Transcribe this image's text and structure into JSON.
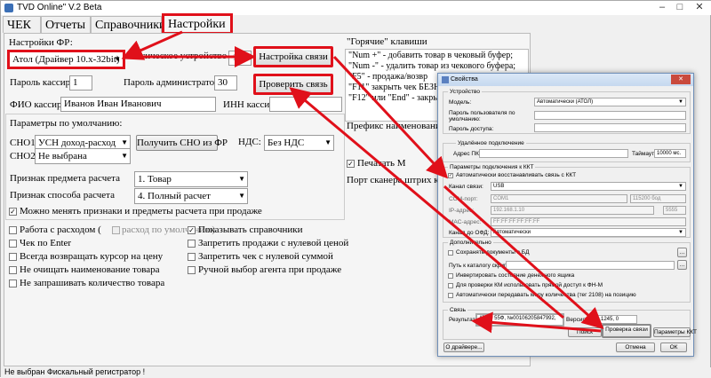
{
  "window": {
    "title": "TVD Online\" V.2 Beta"
  },
  "tabs": [
    "ЧЕК",
    "Отчеты",
    "Справочники",
    "Настройки"
  ],
  "settings": {
    "fr_label": "Настройки ФР:",
    "fr_driver": "Атол (Драйвер 10.х-32bit)",
    "logical_device_label": "Логическое устройство",
    "logical_device_value": "1",
    "connect_settings_button": "Настройка связи",
    "check_connection_button": "Проверить связь",
    "cashier_password_label": "Пароль кассира",
    "cashier_password_value": "1",
    "admin_password_label": "Пароль администратора",
    "admin_password_value": "30",
    "cashier_name_label": "ФИО кассира",
    "cashier_name_value": "Иванов Иван Иванович",
    "cashier_inn_label": "ИНН кассира",
    "defaults_label": "Параметры по умолчанию:",
    "sno1_label": "СНО1:",
    "sno1_value": "УСН доход-расход",
    "sno2_label": "СНО2:",
    "sno2_value": "Не выбрана",
    "get_sno_button": "Получить СНО из ФР",
    "vat_label": "НДС:",
    "vat_value": "Без НДС",
    "calc_subject_label": "Признак предмета расчета",
    "calc_subject_value": "1. Товар",
    "calc_method_label": "Признак способа расчета",
    "calc_method_value": "4. Полный расчет",
    "allow_change_label": "Можно менять признаки и предметы расчета при продаже",
    "options_left": [
      "Работа с расходом (",
      "Чек по Enter",
      "Всегда возвращать курсор на цену",
      "Не очищать наименование товара",
      "Не запрашивать количество товара"
    ],
    "expense_default_label": "расход по умолчанию)",
    "options_right": [
      "Показывать справочники",
      "Запретить продажи с нулевой ценой",
      "Запретить чек с нулевой суммой",
      "Ручной выбор агента при продаже"
    ],
    "hotkeys_title": "\"Горячие\" клавиши",
    "hotkeys": [
      "\"Num +\" - добавить товар в чековый буфер;",
      "\"Num -\"  - удалить товар из чекового буфера;",
      "\"F5\"       - продажа/возвр",
      "\"F11\"   закрыть чек БЕЗН",
      "\"F12\"  или \"End\" - закрыть"
    ],
    "prefix_label": "Префикс наименования то",
    "print_label": "Печатать М",
    "scanner_label": "Порт сканера штрих кодов"
  },
  "status": "Не выбран Фискальный регистратор !",
  "dialog": {
    "title": "Свойства",
    "device_group": "Устройство",
    "model_label": "Модель:",
    "model_value": "Автоматически (АТОЛ)",
    "user_password_label": "Пароль пользователя по умолчанию:",
    "access_password_label": "Пароль доступа:",
    "remote_group": "Удалённое подключение",
    "pc_address_label": "Адрес ПК:",
    "timeout_label": "Таймаут",
    "timeout_value": "10000 мс.",
    "kkt_params_group": "Параметры подключения к ККТ",
    "auto_restore_label": "Автоматически восстанавливать связь с ККТ",
    "channel_label": "Канал связи:",
    "channel_value": "USB",
    "com_label": "COM-порт:",
    "com_value": "COM1",
    "baud_value": "115200 бод",
    "ip_label": "IP-адрес:",
    "ip_value": "192.168.1.10",
    "port_value": "5555",
    "mac_label": "MAC-адрес:",
    "mac_value": "FF:FF:FF:FF:FF:FF",
    "ofd_channel_label": "Канал до ОФД:",
    "ofd_channel_value": "Автоматически",
    "extra_group": "Дополнительно",
    "save_docs_label": "Сохранять документы в БД",
    "scripts_path_label": "Путь к каталогу скриптов:",
    "invert_drawer_label": "Инвертировать состояние денежного ящика",
    "direct_fn_label": "Для проверки КМ использовать прямой доступ к ФН-М",
    "auto_measure_label": "Автоматически передавать меру количества (тег 2108) на позицию",
    "link_group": "Связь",
    "result_label": "Результат:",
    "result_value": "АТОЛ 55Ф, №00106205847992,",
    "version_value": "3.0.1245, 0",
    "version_label": "Версия:",
    "search_button": "Поиск",
    "check_button": "Проверка связи",
    "kkt_params_button": "Параметры ККТ",
    "about_button": "О драйвере...",
    "cancel_button": "Отмена",
    "ok_button": "ОК"
  },
  "accent_color": "#e0101a"
}
